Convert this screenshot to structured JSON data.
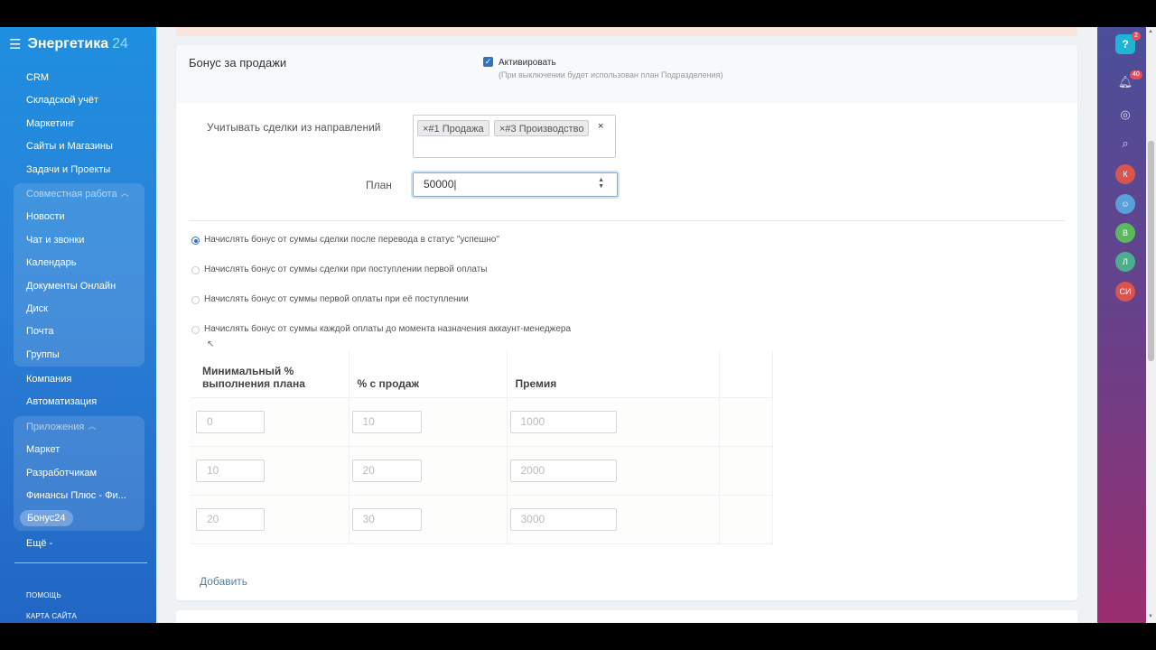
{
  "app": {
    "title": "Энергетика",
    "title_num": "24"
  },
  "sidebar": {
    "items_top": [
      "CRM",
      "Складской учёт",
      "Маркетинг",
      "Сайты и Магазины",
      "Задачи и Проекты"
    ],
    "group1": {
      "title": "Совместная работа",
      "items": [
        "Новости",
        "Чат и звонки",
        "Календарь",
        "Документы Онлайн",
        "Диск",
        "Почта",
        "Группы"
      ]
    },
    "items_mid": [
      "Компания",
      "Автоматизация"
    ],
    "group2": {
      "title": "Приложения",
      "items": [
        "Маркет",
        "Разработчикам",
        "Финансы Плюс - Фи...",
        "Бонус24"
      ],
      "active": "Бонус24"
    },
    "more": "Ещё -",
    "footer": [
      "ПОМОЩЬ",
      "КАРТА САЙТА"
    ]
  },
  "card": {
    "title": "Бонус за продажи",
    "activate_label": "Активировать",
    "activate_checked": true,
    "activate_hint": "(При выключении будет использован план Подразделения)",
    "directions_label": "Учитывать сделки из направлений",
    "directions_tags": [
      "×#1 Продажа",
      "×#3 Производство"
    ],
    "clear_symbol": "×",
    "plan_label": "План",
    "plan_value": "50000",
    "radios": [
      {
        "label": "Начислять бонус от суммы сделки после перевода в статус \"успешно\"",
        "checked": true
      },
      {
        "label": "Начислять бонус от суммы сделки при поступлении первой оплаты",
        "checked": false
      },
      {
        "label": "Начислять бонус от суммы первой оплаты при её поступлении",
        "checked": false
      },
      {
        "label": "Начислять бонус от суммы каждой оплаты до момента назначения аккаунт-менеджера",
        "checked": false
      }
    ],
    "table": {
      "headers": [
        "Минимальный % выполнения плана",
        "% с продаж",
        "Премия"
      ],
      "rows": [
        [
          "0",
          "10",
          "1000"
        ],
        [
          "10",
          "20",
          "2000"
        ],
        [
          "20",
          "30",
          "3000"
        ]
      ]
    },
    "add_label": "Добавить"
  },
  "rightbar": {
    "help_badge": "2",
    "notif_badge": "40",
    "avatars": [
      {
        "initials": "К",
        "color": "#d9534f"
      },
      {
        "initials": "В",
        "color": "#5cb85c"
      },
      {
        "initials": "Л",
        "color": "#4cae8c"
      },
      {
        "initials": "СИ",
        "color": "#d9534f"
      }
    ],
    "help_icon": "?"
  },
  "colors": {
    "sidebar": "#2a7fd6",
    "accent": "#2f72c4",
    "rightbar": "#6b3f88"
  }
}
